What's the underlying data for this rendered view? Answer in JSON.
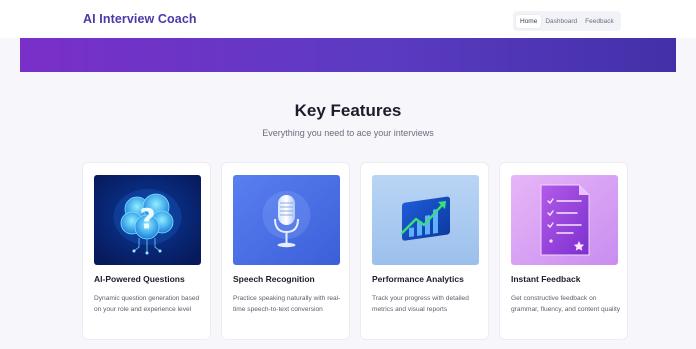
{
  "header": {
    "brand": "AI Interview Coach",
    "nav": [
      {
        "label": "Home",
        "active": true
      },
      {
        "label": "Dashboard",
        "active": false
      },
      {
        "label": "Feedback",
        "active": false
      }
    ]
  },
  "features": {
    "title": "Key Features",
    "subtitle": "Everything you need to ace your interviews",
    "cards": [
      {
        "icon": "brain-question-icon",
        "title": "AI-Powered Questions",
        "description": "Dynamic question generation based on your role and experience level"
      },
      {
        "icon": "microphone-icon",
        "title": "Speech Recognition",
        "description": "Practice speaking naturally with real-time speech-to-text conversion"
      },
      {
        "icon": "analytics-chart-icon",
        "title": "Performance Analytics",
        "description": "Track your progress with detailed metrics and visual reports"
      },
      {
        "icon": "feedback-checklist-icon",
        "title": "Instant Feedback",
        "description": "Get constructive feedback on grammar, fluency, and content quality"
      }
    ]
  },
  "colors": {
    "brand": "#4a3aa8",
    "banner_start": "#7a2fc9",
    "banner_end": "#4330a8"
  }
}
